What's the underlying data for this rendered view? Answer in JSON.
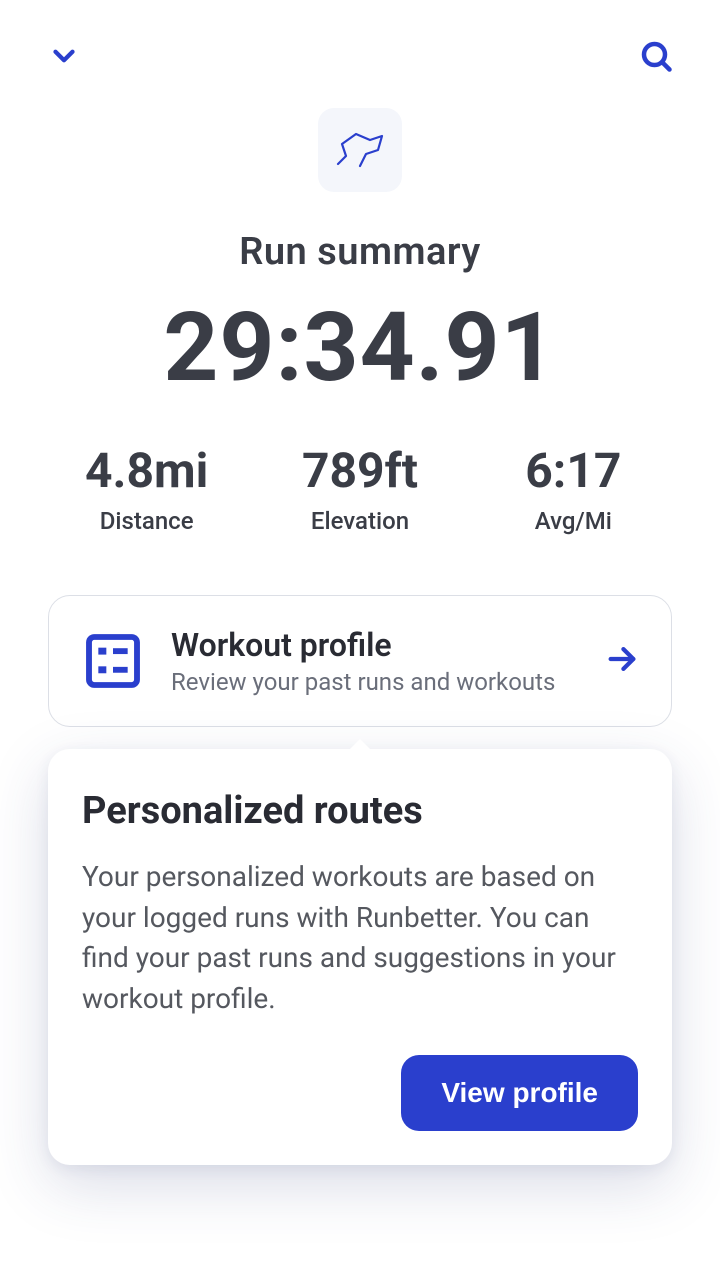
{
  "summary": {
    "title": "Run summary",
    "time": "29:34.91",
    "stats": [
      {
        "value": "4.8mi",
        "label": "Distance"
      },
      {
        "value": "789ft",
        "label": "Elevation"
      },
      {
        "value": "6:17",
        "label": "Avg/Mi"
      }
    ]
  },
  "profile_card": {
    "title": "Workout profile",
    "subtitle": "Review your past runs and workouts"
  },
  "popover": {
    "title": "Personalized routes",
    "body": "Your personalized workouts are based on your logged runs with Runbetter. You can find your past runs and suggestions in your workout profile.",
    "cta": "View profile"
  },
  "colors": {
    "accent": "#2A3FCD"
  }
}
